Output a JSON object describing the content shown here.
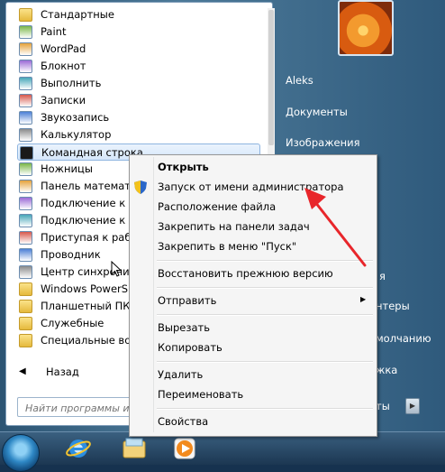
{
  "programs": [
    {
      "label": "Стандартные",
      "kind": "folder",
      "icon": "folder-icon"
    },
    {
      "label": "Paint",
      "kind": "app",
      "icon": "paint-icon"
    },
    {
      "label": "WordPad",
      "kind": "app",
      "icon": "wordpad-icon"
    },
    {
      "label": "Блокнот",
      "kind": "app",
      "icon": "notepad-icon"
    },
    {
      "label": "Выполнить",
      "kind": "app",
      "icon": "run-icon"
    },
    {
      "label": "Записки",
      "kind": "app",
      "icon": "sticky-notes-icon"
    },
    {
      "label": "Звукозапись",
      "kind": "app",
      "icon": "sound-recorder-icon"
    },
    {
      "label": "Калькулятор",
      "kind": "app",
      "icon": "calculator-icon"
    },
    {
      "label": "Командная строка",
      "kind": "app",
      "icon": "cmd-icon",
      "selected": true
    },
    {
      "label": "Ножницы",
      "kind": "app",
      "icon": "scissors-icon"
    },
    {
      "label": "Панель математи",
      "kind": "app",
      "icon": "math-panel-icon"
    },
    {
      "label": "Подключение к у",
      "kind": "app",
      "icon": "remote-desktop-icon"
    },
    {
      "label": "Подключение к п",
      "kind": "app",
      "icon": "projector-icon"
    },
    {
      "label": "Приступая к рабо",
      "kind": "app",
      "icon": "getting-started-icon"
    },
    {
      "label": "Проводник",
      "kind": "app",
      "icon": "explorer-icon"
    },
    {
      "label": "Центр синхрониз",
      "kind": "app",
      "icon": "sync-center-icon"
    },
    {
      "label": "Windows PowerSh",
      "kind": "folder",
      "icon": "folder-icon"
    },
    {
      "label": "Планшетный ПК",
      "kind": "folder",
      "icon": "folder-icon"
    },
    {
      "label": "Служебные",
      "kind": "folder",
      "icon": "folder-icon"
    },
    {
      "label": "Специальные воз",
      "kind": "folder",
      "icon": "folder-icon"
    }
  ],
  "back_label": "Назад",
  "search": {
    "placeholder": "Найти программы и"
  },
  "right_pane": {
    "items": [
      "Aleks",
      "Документы",
      "Изображения"
    ],
    "partial_items": [
      "я",
      "нтеры",
      "молчанию",
      "жка"
    ],
    "shutdown_label": "ты"
  },
  "context_menu": {
    "items": [
      {
        "label": "Открыть",
        "bold": true
      },
      {
        "label": "Запуск от имени администратора",
        "icon": "uac-shield-icon"
      },
      {
        "label": "Расположение файла"
      },
      {
        "label": "Закрепить на панели задач"
      },
      {
        "label": "Закрепить в меню \"Пуск\""
      },
      {
        "label": "Восстановить прежнюю версию"
      },
      {
        "label": "Отправить",
        "submenu": true
      },
      {
        "label": "Вырезать"
      },
      {
        "label": "Копировать"
      },
      {
        "label": "Удалить"
      },
      {
        "label": "Переименовать"
      },
      {
        "label": "Свойства"
      }
    ]
  },
  "taskbar": {
    "buttons": [
      "start-orb",
      "internet-explorer-icon",
      "windows-explorer-icon",
      "media-player-icon"
    ]
  },
  "colors": {
    "highlight_arrow": "#e8262b",
    "selection": "#d6e7fa"
  }
}
